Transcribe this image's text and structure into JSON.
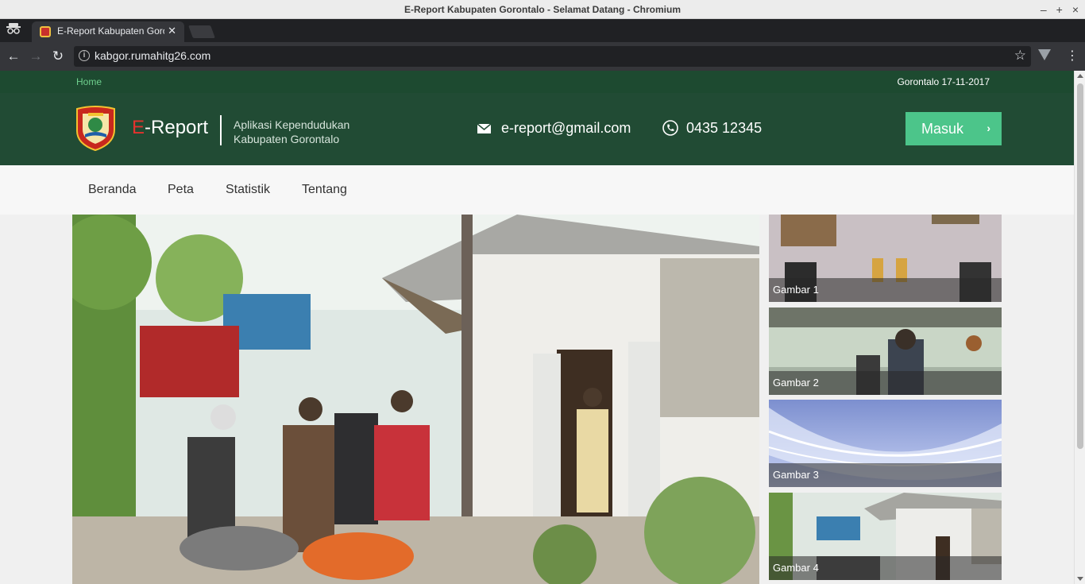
{
  "window": {
    "title": "E-Report Kabupaten Gorontalo - Selamat Datang - Chromium",
    "controls": [
      "–",
      "+",
      "×"
    ]
  },
  "browser": {
    "tab_title": "E-Report Kabupaten Gorontalo - Selamat Datang",
    "url": "kabgor.rumahitg26.com"
  },
  "page": {
    "topbar": {
      "home_link": "Home",
      "location_date": "Gorontalo 17-11-2017"
    },
    "header": {
      "brand_first": "E",
      "brand_rest": "-Report",
      "tagline_line1": "Aplikasi Kependudukan",
      "tagline_line2": "Kabupaten Gorontalo",
      "email": "e-report@gmail.com",
      "phone": "0435 12345",
      "login_button": "Masuk"
    },
    "nav": [
      "Beranda",
      "Peta",
      "Statistik",
      "Tentang"
    ],
    "gallery": [
      "Gambar 1",
      "Gambar 2",
      "Gambar 3",
      "Gambar 4"
    ]
  },
  "colors": {
    "topbar_bg": "#1d4a30",
    "header_bg": "#214b34",
    "login_button": "#4cc58a",
    "brand_accent": "#e5322d"
  }
}
